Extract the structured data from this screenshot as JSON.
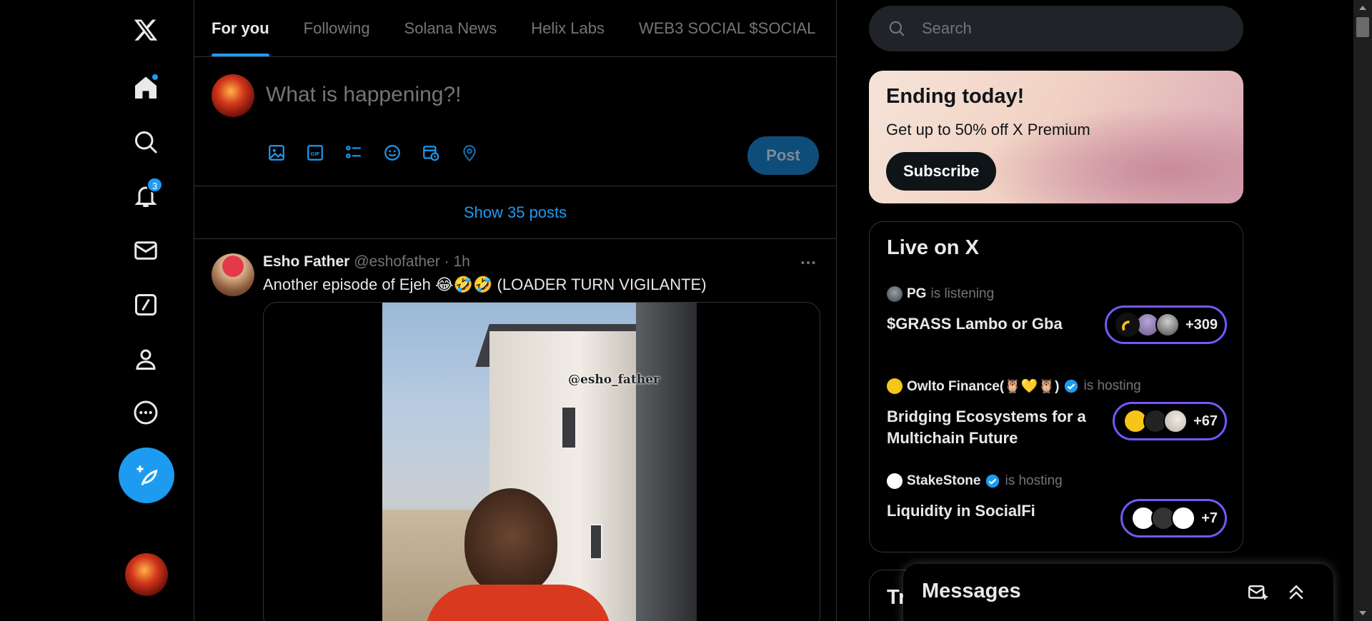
{
  "nav": {
    "items": [
      {
        "name": "x-logo"
      },
      {
        "name": "home",
        "dot": true
      },
      {
        "name": "explore"
      },
      {
        "name": "notifications",
        "badge": "3"
      },
      {
        "name": "messages"
      },
      {
        "name": "grok"
      },
      {
        "name": "profile"
      },
      {
        "name": "more"
      }
    ],
    "notifications_badge": "3"
  },
  "tabs": [
    "For you",
    "Following",
    "Solana News",
    "Helix Labs",
    "WEB3 SOCIAL $SOCIAL"
  ],
  "composer": {
    "placeholder": "What is happening?!",
    "post_label": "Post"
  },
  "feed": {
    "show_posts": "Show 35 posts",
    "tweet": {
      "name": "Esho Father",
      "handle": "@eshofather",
      "time": "1h",
      "text": "Another episode of Ejeh 😂🤣🤣 (LOADER TURN VIGILANTE)",
      "watermark": "@esho_father"
    }
  },
  "search": {
    "placeholder": "Search"
  },
  "premium": {
    "title": "Ending today!",
    "body": "Get up to 50% off X Premium",
    "cta": "Subscribe"
  },
  "live": {
    "title": "Live on X",
    "spaces": [
      {
        "host": "PG",
        "status": "is listening",
        "verified": false,
        "title": "$GRASS Lambo or Gba",
        "count": "+309"
      },
      {
        "host": "Owlto Finance(🦉💛🦉)",
        "status": "is hosting",
        "verified": true,
        "title": "Bridging Ecosystems for a Multichain Future",
        "count": "+67"
      },
      {
        "host": "StakeStone",
        "status": "is hosting",
        "verified": true,
        "title": "Liquidity in SocialFi",
        "count": "+7"
      }
    ]
  },
  "trends_peek": "Tr",
  "messages": {
    "title": "Messages"
  },
  "colors": {
    "accent": "#1d9bf0",
    "live_pill_border": "#7856ff",
    "background": "#000000"
  }
}
